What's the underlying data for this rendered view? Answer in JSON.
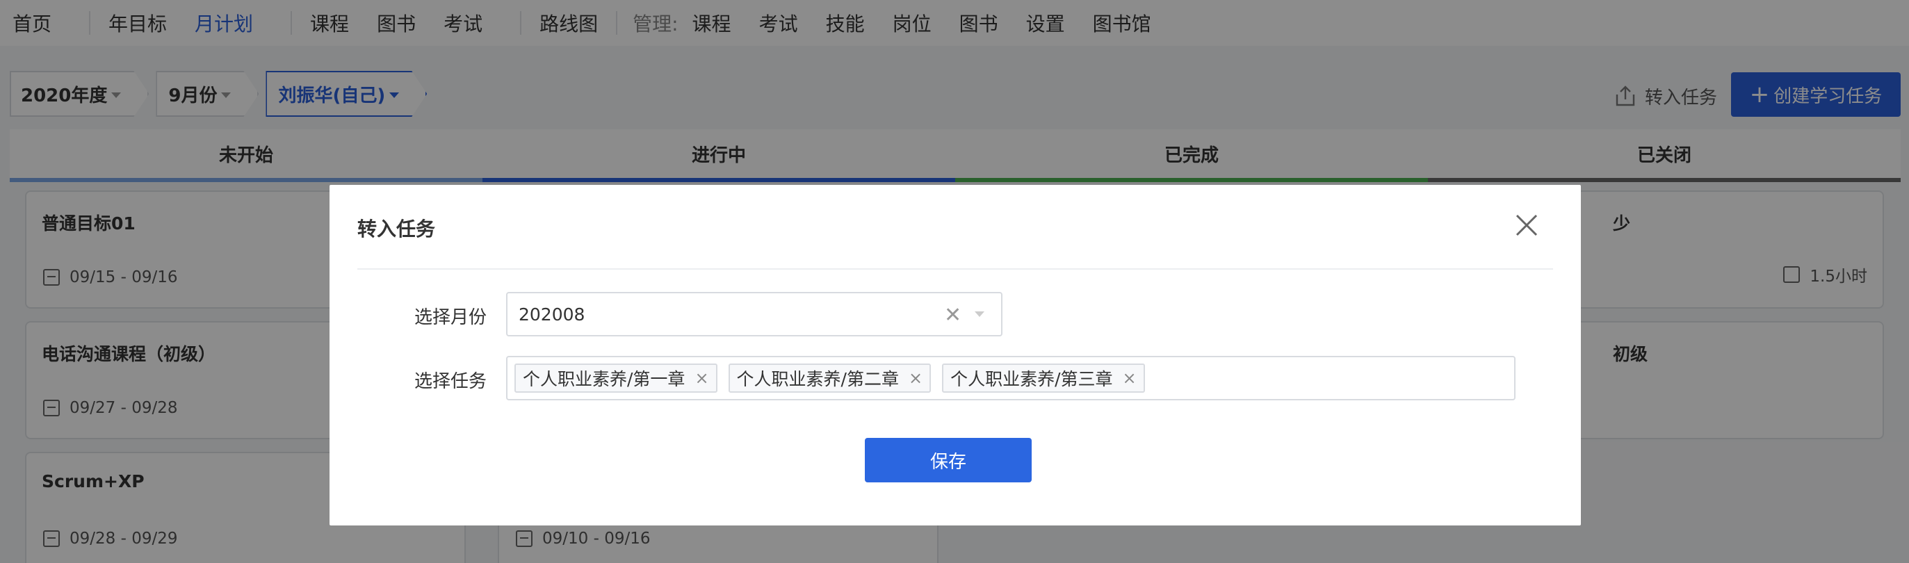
{
  "topnav": {
    "items": [
      {
        "label": "首页"
      },
      {
        "label": "年目标"
      },
      {
        "label": "月计划"
      },
      {
        "label": "课程"
      },
      {
        "label": "图书"
      },
      {
        "label": "考试"
      },
      {
        "label": "路线图"
      }
    ],
    "manage_label": "管理:",
    "manage_items": [
      {
        "label": "课程"
      },
      {
        "label": "考试"
      },
      {
        "label": "技能"
      },
      {
        "label": "岗位"
      },
      {
        "label": "图书"
      },
      {
        "label": "设置"
      },
      {
        "label": "图书馆"
      }
    ]
  },
  "toolbar": {
    "crumbs": [
      "2020年度",
      "9月份",
      "刘振华(自己)"
    ],
    "import_label": "转入任务",
    "create_label": "创建学习任务",
    "create_plus": "+"
  },
  "columns": [
    {
      "title": "未开始",
      "cards": [
        {
          "title": "普通目标01",
          "date": "09/15 - 09/16"
        },
        {
          "title": "电话沟通课程（初级）",
          "date": "09/27 - 09/28"
        },
        {
          "title": "Scrum+XP",
          "date": "09/28 - 09/29"
        }
      ]
    },
    {
      "title": "进行中",
      "cards": [
        {
          "title": "",
          "date": ""
        },
        {
          "title": "",
          "date": ""
        },
        {
          "title": "",
          "date": "09/10 - 09/16"
        }
      ]
    },
    {
      "title": "已完成",
      "cards": []
    },
    {
      "title": "已关闭",
      "cards": [
        {
          "title": "少",
          "duration": "1.5小时"
        },
        {
          "title": "初级"
        }
      ]
    }
  ],
  "modal": {
    "title": "转入任务",
    "month_label": "选择月份",
    "month_value": "202008",
    "task_label": "选择任务",
    "tags": [
      "个人职业素养/第一章",
      "个人职业素养/第二章",
      "个人职业素养/第三章"
    ],
    "save_label": "保存",
    "clear_glyph": "✕",
    "tag_remove_glyph": "×"
  },
  "colors": {
    "primary": "#2b5fd9",
    "col_not_started": "#7aa7e6",
    "col_in_progress": "#2b5fd9",
    "col_done": "#4caf50",
    "col_closed": "#666666"
  },
  "icons": {
    "import": "upload-icon",
    "close": "close-icon",
    "calendar": "calendar-icon",
    "clock": "clock-icon"
  }
}
